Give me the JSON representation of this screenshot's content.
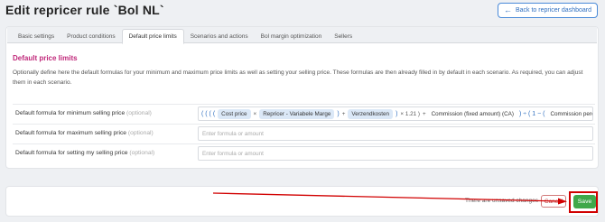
{
  "header": {
    "title": "Edit repricer rule `Bol NL`",
    "back_label": "Back to repricer dashboard"
  },
  "tabs": [
    {
      "label": "Basic settings",
      "active": false
    },
    {
      "label": "Product conditions",
      "active": false
    },
    {
      "label": "Default price limits",
      "active": true
    },
    {
      "label": "Scenarios and actions",
      "active": false
    },
    {
      "label": "Bol margin optimization",
      "active": false
    },
    {
      "label": "Sellers",
      "active": false
    }
  ],
  "section": {
    "title": "Default price limits",
    "description": "Optionally define here the default formulas for your minimum and maximum price limits as well as setting your selling price. These formulas are then already filled in by default in each scenario. As required, you can adjust them in each scenario."
  },
  "fields": [
    {
      "label": "Default formula for minimum selling price",
      "optional": "(optional)",
      "value": "",
      "placeholder": "",
      "formula": [
        {
          "kind": "op",
          "text": "( ( ( ("
        },
        {
          "kind": "chip",
          "text": "Cost price"
        },
        {
          "kind": "text",
          "text": "×"
        },
        {
          "kind": "chip",
          "text": "Repricer - Variabele Marge"
        },
        {
          "kind": "op",
          "text": ")"
        },
        {
          "kind": "text",
          "text": "+"
        },
        {
          "kind": "chip",
          "text": "Verzendkosten"
        },
        {
          "kind": "op",
          "text": ")"
        },
        {
          "kind": "text",
          "text": "× 1.21 )"
        },
        {
          "kind": "text",
          "text": "+"
        },
        {
          "kind": "plain",
          "text": "Commission (fixed amount) (CA)"
        },
        {
          "kind": "op",
          "text": ") ÷ ( 1 − ("
        },
        {
          "kind": "plain",
          "text": "Commission percentage"
        }
      ]
    },
    {
      "label": "Default formula for maximum selling price",
      "optional": "(optional)",
      "value": "",
      "placeholder": "Enter formula or amount"
    },
    {
      "label": "Default formula for setting my selling price",
      "optional": "(optional)",
      "value": "",
      "placeholder": "Enter formula or amount"
    }
  ],
  "footer": {
    "unsaved_text": "There are unsaved changes",
    "cancel_label": "Cancel",
    "save_label": "Save"
  },
  "colors": {
    "accent": "#2f6fc0",
    "section_title": "#c0287a",
    "save_green": "#3fa84a",
    "annotation_red": "#d10000"
  }
}
